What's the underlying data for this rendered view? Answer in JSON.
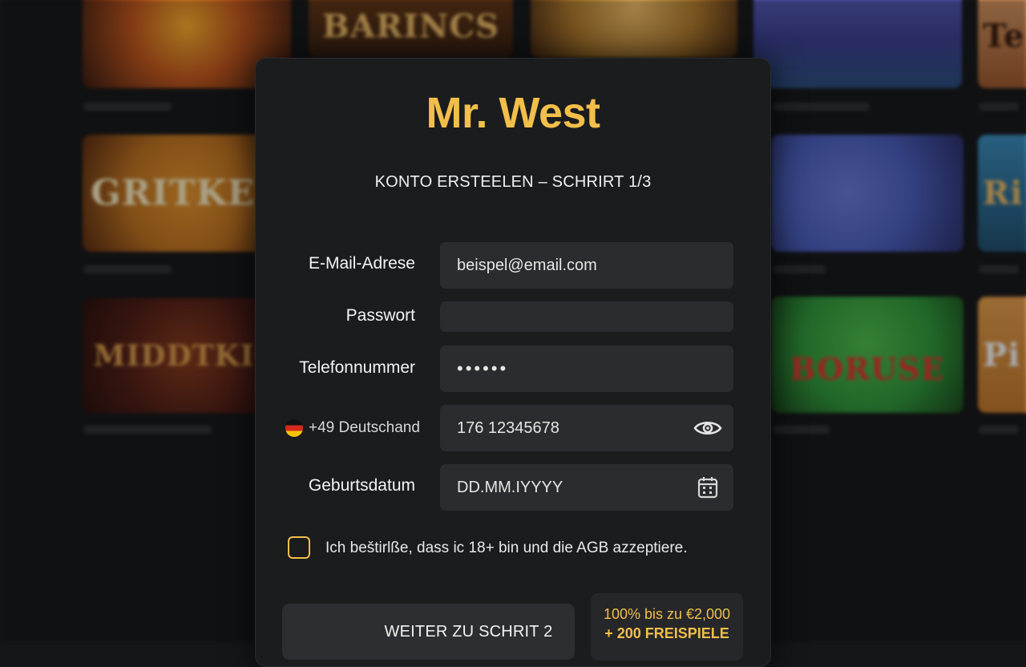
{
  "background": {
    "tiles": [
      {
        "title": "",
        "color": "#c2561a"
      },
      {
        "title": "BARINCS",
        "color": "#8a4a1a"
      },
      {
        "title": "",
        "color": "#b07a2a"
      },
      {
        "title": "",
        "color": "#4b4f8f"
      },
      {
        "title": "Te",
        "color": "#a05a2a"
      },
      {
        "title": "GRITKEE",
        "color": "#c2741e"
      },
      {
        "title": "",
        "color": "#4a5fc0"
      },
      {
        "title": "Ri",
        "color": "#2f6f9f"
      },
      {
        "title": "MIDDTKIG",
        "color": "#6a2a1a"
      },
      {
        "title": "BORUSE",
        "color": "#2f9a3a"
      },
      {
        "title": "Pi",
        "color": "#c57a2a"
      }
    ]
  },
  "modal": {
    "logo": "Mr. West",
    "step_title": "KONTO ERSTEELEN – SCHRIRT 1/3",
    "fields": {
      "email": {
        "label": "E-Mail-Adrese",
        "value": "beispel@email.com"
      },
      "password": {
        "label": "Passwort",
        "value": ""
      },
      "phone": {
        "label": "Telefonnummer",
        "value": "••••••"
      },
      "phone_number": {
        "country": "+49 Deutschand",
        "value": "176 12345678",
        "icon": "eye-icon"
      },
      "birthdate": {
        "label": "Geburtsdatum",
        "placeholder": "DD.MM.IYYYY",
        "icon": "calendar-icon"
      }
    },
    "terms_label": "Ich beštirlße, dass ic 18+ bin und die AGB azzeptiere.",
    "next_button": "WEITER ZU SCHRIT 2",
    "bonus": {
      "line1": "100% bis zu €2,000",
      "line2": "+ 200 FREISPIELE"
    }
  },
  "colors": {
    "accent": "#f2bf4a",
    "modal_bg": "#1b1c1e",
    "field_bg": "#2b2c2f"
  }
}
